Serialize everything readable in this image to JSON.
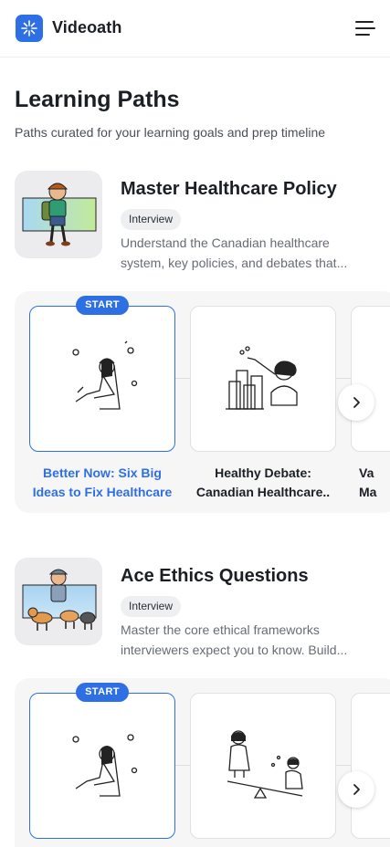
{
  "app": {
    "name": "Videoath",
    "logo_icon": "sparkle-icon",
    "menu_icon": "hamburger-menu-icon"
  },
  "header": {
    "title": "Learning Paths",
    "subtitle": "Paths curated for your learning goals and prep timeline"
  },
  "paths": [
    {
      "title": "Master Healthcare Policy",
      "tag": "Interview",
      "description_line1": "Understand the Canadian healthcare",
      "description_line2": "system, key policies, and debates that...",
      "thumbnail_icon": "hiker-with-backpack-illustration",
      "lessons": [
        {
          "badge": "START",
          "label_line1": "Better Now: Six Big",
          "label_line2": "Ideas to Fix Healthcare",
          "illustration": "person-sitting-with-headphones-illustration"
        },
        {
          "label_line1": "Healthy Debate:",
          "label_line2": "Canadian Healthcare..",
          "illustration": "person-stacking-blocks-illustration"
        },
        {
          "label_line1": "Va",
          "label_line2": "Ma",
          "illustration": "partial-card-illustration"
        }
      ],
      "next_icon": "chevron-right-icon"
    },
    {
      "title": "Ace Ethics Questions",
      "tag": "Interview",
      "description_line1": "Master the core ethical frameworks",
      "description_line2": "interviewers expect you to know. Build...",
      "thumbnail_icon": "person-walking-dogs-illustration",
      "lessons": [
        {
          "badge": "START",
          "illustration": "person-sitting-with-headphones-illustration"
        },
        {
          "illustration": "people-on-seesaw-illustration"
        },
        {
          "illustration": "partial-card-illustration"
        }
      ],
      "next_icon": "chevron-right-icon"
    }
  ],
  "colors": {
    "accent": "#2f6fe4",
    "carousel_bg": "#f6f6f7",
    "thumb_bg": "#ececee"
  }
}
